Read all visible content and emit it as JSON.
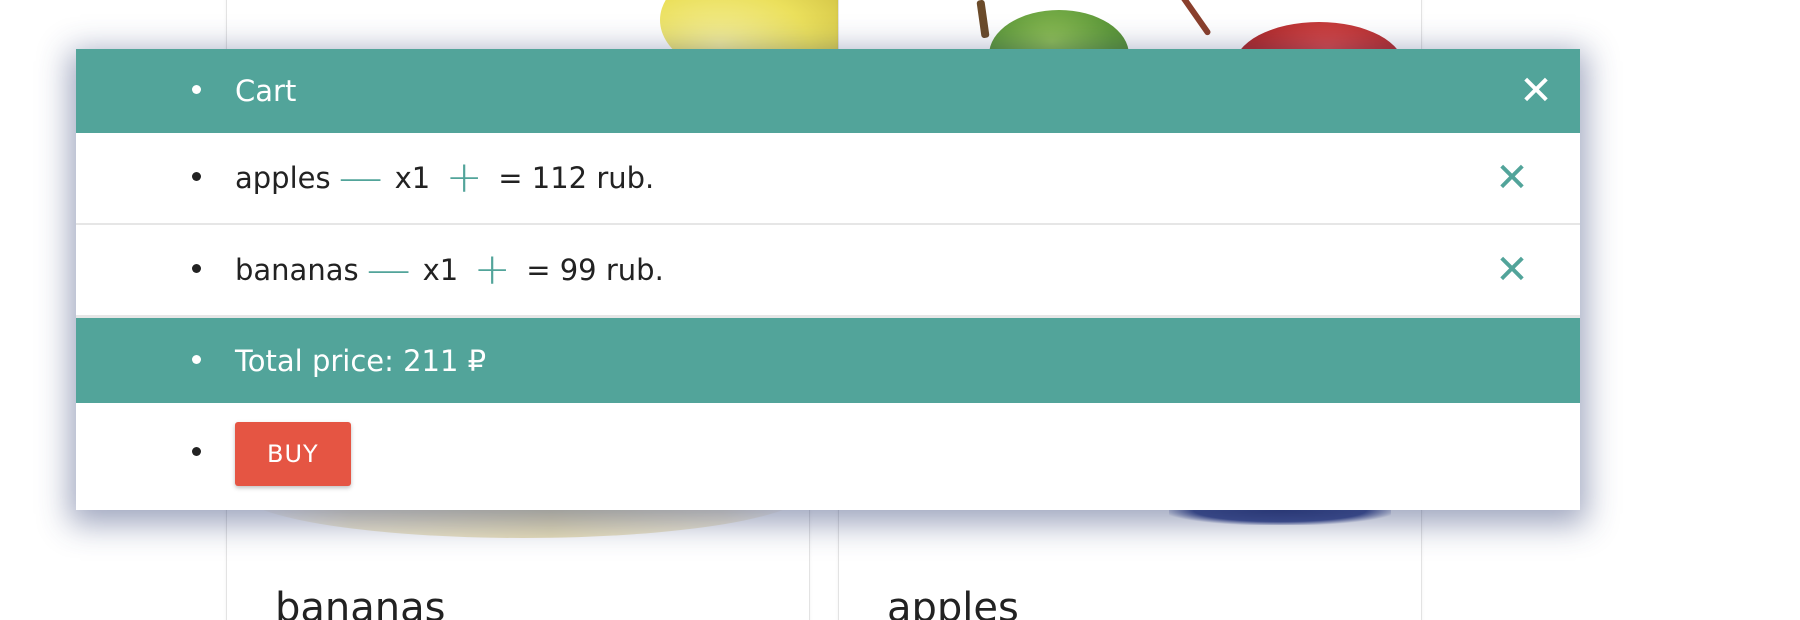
{
  "background": {
    "cards": [
      {
        "title": "bananas"
      },
      {
        "title": "apples"
      }
    ]
  },
  "cart": {
    "title": "Cart",
    "close_icon": "close-icon",
    "items": [
      {
        "name": "apples",
        "minus_icon": "minus-icon",
        "qty": "x1",
        "plus_icon": "plus-icon",
        "price": "= 112 rub.",
        "remove_icon": "remove-icon"
      },
      {
        "name": "bananas",
        "minus_icon": "minus-icon",
        "qty": "x1",
        "plus_icon": "plus-icon",
        "price": "= 99 rub.",
        "remove_icon": "remove-icon"
      }
    ],
    "total": "Total price: 211 ₽",
    "buy_label": "BUY"
  },
  "colors": {
    "accent": "#52a49a",
    "buy_button": "#e55543"
  }
}
